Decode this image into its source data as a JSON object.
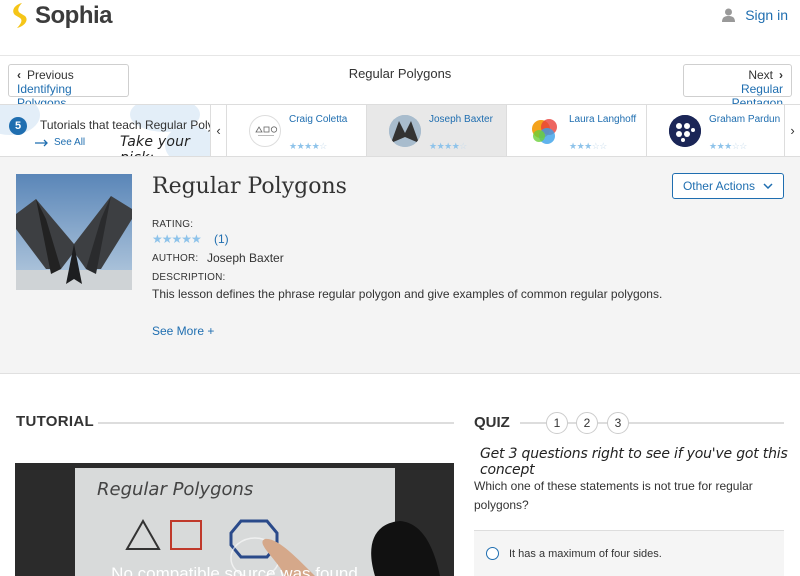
{
  "header": {
    "brand": "Sophia",
    "signin_label": "Sign in"
  },
  "nav": {
    "prev_label": "Previous",
    "prev_title": "Identifying Polygons",
    "page_title": "Regular Polygons",
    "next_label": "Next",
    "next_title": "Regular Pentagon"
  },
  "tutorials": {
    "count": "5",
    "label": "Tutorials that teach Regular Polygons",
    "see_all": "See All",
    "pick_text": "Take your pick:",
    "cards": [
      {
        "name": "Craig Coletta",
        "stars": 4,
        "selected": false
      },
      {
        "name": "Joseph Baxter",
        "stars": 4,
        "selected": true
      },
      {
        "name": "Laura Langhoff",
        "stars": 3,
        "selected": false
      },
      {
        "name": "Graham Pardun",
        "stars": 3,
        "selected": false
      }
    ]
  },
  "lesson": {
    "title": "Regular Polygons",
    "other_actions": "Other Actions",
    "rating_label": "RATING:",
    "rating_stars": 5,
    "rating_count": "(1)",
    "author_label": "AUTHOR:",
    "author": "Joseph Baxter",
    "description_label": "DESCRIPTION:",
    "description": "This lesson defines the phrase regular polygon and give examples of common regular polygons.",
    "see_more": "See More +"
  },
  "tutorial_section": {
    "heading": "TUTORIAL",
    "video_message": "No compatible source was found"
  },
  "quiz": {
    "heading": "QUIZ",
    "numbers": [
      "1",
      "2",
      "3"
    ],
    "tagline": "Get 3 questions right to see if you've got this concept",
    "question": "Which one of these statements is not true for regular polygons?",
    "answer": "It has a maximum of four sides."
  },
  "colors": {
    "accent": "#1f6eb0",
    "logo": "#f5c518",
    "stars": "#8ec3ea"
  }
}
